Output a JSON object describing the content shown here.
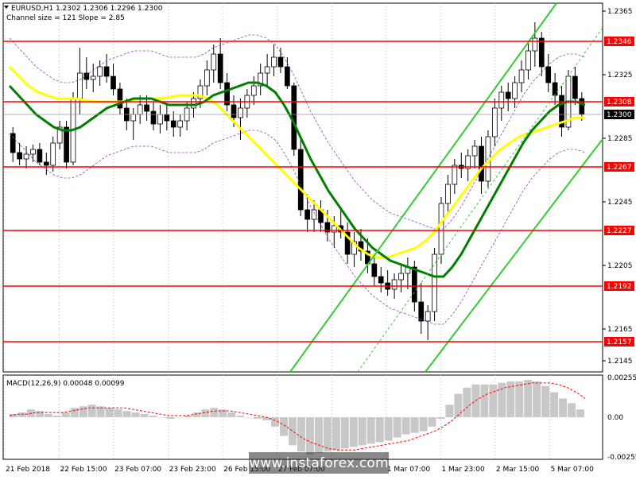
{
  "chart_data": [
    {
      "type": "line",
      "title": "EURUSD,H1  1.2302 1.2306 1.2296 1.2300",
      "subtitle": "Channel size = 121 Slope = 2.85",
      "ylim": [
        1.2138,
        1.237
      ],
      "y_ticks": [
        "1.2365",
        "1.2325",
        "1.2285",
        "1.2245",
        "1.2205",
        "1.2165",
        "1.2145"
      ],
      "x_ticks": [
        "21 Feb 2018",
        "22 Feb 15:00",
        "23 Feb 07:00",
        "23 Feb 23:00",
        "26 Feb 15:00",
        "27 Feb 07:00",
        "",
        "1 Mar 07:00",
        "1 Mar 23:00",
        "2 Mar 15:00",
        "5 Mar 07:00"
      ],
      "level_lines": [
        {
          "value": 1.2346,
          "label": "1.2346"
        },
        {
          "value": 1.2308,
          "label": "1.2308"
        },
        {
          "value": 1.2267,
          "label": "1.2267"
        },
        {
          "value": 1.2227,
          "label": "1.2227"
        },
        {
          "value": 1.2192,
          "label": "1.2192"
        },
        {
          "value": 1.2157,
          "label": "1.2157"
        }
      ],
      "current_price": {
        "value": 1.23,
        "label": "1.2300"
      },
      "candles": [
        [
          1.2288,
          1.2292,
          1.227,
          1.2276
        ],
        [
          1.2276,
          1.2282,
          1.2268,
          1.2272
        ],
        [
          1.2272,
          1.228,
          1.2266,
          1.2275
        ],
        [
          1.2275,
          1.2281,
          1.227,
          1.2278
        ],
        [
          1.2278,
          1.2282,
          1.2268,
          1.227
        ],
        [
          1.227,
          1.2276,
          1.2262,
          1.2268
        ],
        [
          1.2268,
          1.2286,
          1.2264,
          1.2282
        ],
        [
          1.2282,
          1.2296,
          1.2278,
          1.2292
        ],
        [
          1.2292,
          1.2296,
          1.2266,
          1.227
        ],
        [
          1.227,
          1.2314,
          1.2268,
          1.231
        ],
        [
          1.231,
          1.2342,
          1.23,
          1.2326
        ],
        [
          1.2326,
          1.2336,
          1.2316,
          1.2322
        ],
        [
          1.2322,
          1.2332,
          1.2314,
          1.2324
        ],
        [
          1.2324,
          1.2334,
          1.2318,
          1.233
        ],
        [
          1.233,
          1.2338,
          1.232,
          1.2324
        ],
        [
          1.2324,
          1.2332,
          1.2312,
          1.2316
        ],
        [
          1.2316,
          1.232,
          1.23,
          1.2304
        ],
        [
          1.2304,
          1.231,
          1.229,
          1.2296
        ],
        [
          1.2296,
          1.2304,
          1.2284,
          1.23
        ],
        [
          1.23,
          1.2312,
          1.2294,
          1.2306
        ],
        [
          1.2306,
          1.2312,
          1.2296,
          1.2302
        ],
        [
          1.2302,
          1.2308,
          1.229,
          1.2294
        ],
        [
          1.2294,
          1.2306,
          1.2288,
          1.23
        ],
        [
          1.23,
          1.2306,
          1.229,
          1.2296
        ],
        [
          1.2296,
          1.2302,
          1.2286,
          1.2292
        ],
        [
          1.2292,
          1.23,
          1.2286,
          1.2296
        ],
        [
          1.2296,
          1.2308,
          1.229,
          1.2304
        ],
        [
          1.2304,
          1.2314,
          1.2298,
          1.231
        ],
        [
          1.231,
          1.2322,
          1.2304,
          1.2318
        ],
        [
          1.2318,
          1.2334,
          1.2312,
          1.2328
        ],
        [
          1.2328,
          1.2344,
          1.232,
          1.2338
        ],
        [
          1.2338,
          1.2348,
          1.2316,
          1.232
        ],
        [
          1.232,
          1.2326,
          1.2302,
          1.2306
        ],
        [
          1.2306,
          1.2312,
          1.2292,
          1.2298
        ],
        [
          1.2298,
          1.231,
          1.2284,
          1.2304
        ],
        [
          1.2304,
          1.2316,
          1.2298,
          1.2312
        ],
        [
          1.2312,
          1.2324,
          1.2306,
          1.2318
        ],
        [
          1.2318,
          1.2332,
          1.2312,
          1.2326
        ],
        [
          1.2326,
          1.2338,
          1.2318,
          1.233
        ],
        [
          1.233,
          1.2344,
          1.2324,
          1.2336
        ],
        [
          1.2336,
          1.2342,
          1.2326,
          1.233
        ],
        [
          1.233,
          1.2336,
          1.2316,
          1.2318
        ],
        [
          1.2318,
          1.232,
          1.2274,
          1.2278
        ],
        [
          1.2278,
          1.2284,
          1.2236,
          1.224
        ],
        [
          1.224,
          1.225,
          1.2226,
          1.2234
        ],
        [
          1.2234,
          1.2246,
          1.2226,
          1.224
        ],
        [
          1.224,
          1.2246,
          1.2226,
          1.2232
        ],
        [
          1.2232,
          1.224,
          1.222,
          1.2226
        ],
        [
          1.2226,
          1.2236,
          1.2216,
          1.223
        ],
        [
          1.223,
          1.2242,
          1.2222,
          1.2226
        ],
        [
          1.2226,
          1.2232,
          1.2206,
          1.2212
        ],
        [
          1.2212,
          1.2226,
          1.2204,
          1.222
        ],
        [
          1.222,
          1.2228,
          1.2208,
          1.2214
        ],
        [
          1.2214,
          1.2222,
          1.22,
          1.2206
        ],
        [
          1.2206,
          1.2212,
          1.2192,
          1.2198
        ],
        [
          1.2198,
          1.2204,
          1.2188,
          1.2194
        ],
        [
          1.2194,
          1.2202,
          1.2186,
          1.219
        ],
        [
          1.219,
          1.22,
          1.2184,
          1.2196
        ],
        [
          1.2196,
          1.2206,
          1.2188,
          1.22
        ],
        [
          1.22,
          1.221,
          1.219,
          1.2204
        ],
        [
          1.2204,
          1.2208,
          1.2176,
          1.2182
        ],
        [
          1.2182,
          1.2194,
          1.2162,
          1.217
        ],
        [
          1.217,
          1.218,
          1.2158,
          1.2176
        ],
        [
          1.2176,
          1.2216,
          1.217,
          1.2212
        ],
        [
          1.2212,
          1.2248,
          1.2206,
          1.2244
        ],
        [
          1.2244,
          1.2262,
          1.2238,
          1.2256
        ],
        [
          1.2256,
          1.2272,
          1.225,
          1.2268
        ],
        [
          1.2268,
          1.2276,
          1.226,
          1.2266
        ],
        [
          1.2266,
          1.2278,
          1.2258,
          1.2274
        ],
        [
          1.2274,
          1.2284,
          1.2266,
          1.228
        ],
        [
          1.228,
          1.2286,
          1.225,
          1.2258
        ],
        [
          1.2258,
          1.229,
          1.2254,
          1.2286
        ],
        [
          1.2286,
          1.231,
          1.228,
          1.2304
        ],
        [
          1.2304,
          1.2318,
          1.2296,
          1.2314
        ],
        [
          1.2314,
          1.232,
          1.2302,
          1.231
        ],
        [
          1.231,
          1.2324,
          1.2304,
          1.232
        ],
        [
          1.232,
          1.2334,
          1.2314,
          1.2328
        ],
        [
          1.2328,
          1.2346,
          1.2322,
          1.234
        ],
        [
          1.234,
          1.2358,
          1.233,
          1.2348
        ],
        [
          1.2348,
          1.2352,
          1.2324,
          1.233
        ],
        [
          1.233,
          1.2338,
          1.2314,
          1.232
        ],
        [
          1.232,
          1.2326,
          1.2306,
          1.2312
        ],
        [
          1.2312,
          1.2318,
          1.2286,
          1.2292
        ],
        [
          1.2292,
          1.2328,
          1.229,
          1.2324
        ],
        [
          1.2324,
          1.233,
          1.2306,
          1.231
        ],
        [
          1.231,
          1.2314,
          1.2296,
          1.23
        ]
      ],
      "sma_green": [
        1.2318,
        1.2312,
        1.2306,
        1.23,
        1.2296,
        1.2292,
        1.229,
        1.229,
        1.2292,
        1.2296,
        1.23,
        1.2304,
        1.2306,
        1.2308,
        1.231,
        1.231,
        1.231,
        1.2308,
        1.2306,
        1.2306,
        1.2306,
        1.2306,
        1.2308,
        1.2312,
        1.2314,
        1.2316,
        1.2318,
        1.232,
        1.232,
        1.2318,
        1.2314,
        1.2306,
        1.2296,
        1.2284,
        1.2272,
        1.2262,
        1.2252,
        1.2244,
        1.2236,
        1.2228,
        1.2222,
        1.2216,
        1.2212,
        1.2208,
        1.2206,
        1.2204,
        1.2202,
        1.22,
        1.2198,
        1.2198,
        1.2204,
        1.2212,
        1.2222,
        1.2232,
        1.2242,
        1.2252,
        1.2262,
        1.2272,
        1.2282,
        1.229,
        1.2296,
        1.2302,
        1.2306,
        1.2308,
        1.2308,
        1.2306
      ],
      "sma_yellow": [
        1.233,
        1.2324,
        1.2318,
        1.2314,
        1.2312,
        1.231,
        1.231,
        1.231,
        1.2309,
        1.2308,
        1.2308,
        1.2308,
        1.2308,
        1.2309,
        1.231,
        1.231,
        1.231,
        1.2311,
        1.2312,
        1.2312,
        1.2312,
        1.231,
        1.2306,
        1.23,
        1.2294,
        1.2288,
        1.2282,
        1.2276,
        1.227,
        1.2264,
        1.2258,
        1.2252,
        1.2246,
        1.224,
        1.2234,
        1.2228,
        1.2222,
        1.2216,
        1.2212,
        1.221,
        1.221,
        1.2212,
        1.2214,
        1.2216,
        1.222,
        1.2226,
        1.2234,
        1.2242,
        1.225,
        1.2258,
        1.2266,
        1.2272,
        1.2278,
        1.2282,
        1.2286,
        1.2288,
        1.229,
        1.2292,
        1.2294,
        1.2296,
        1.2298,
        1.2298
      ]
    },
    {
      "type": "bar",
      "title": "MACD(12,26,9) 0.00048 0.00099",
      "ylim": [
        -0.0027,
        0.0027
      ],
      "y_ticks": [
        "0.00255",
        "0.00",
        "-0.00255"
      ],
      "series": [
        {
          "name": "main",
          "values": [
            0.0002,
            0.0003,
            0.0005,
            0.0004,
            0.0002,
            0.0001,
            0.0003,
            0.0006,
            0.0007,
            0.0008,
            0.0007,
            0.0006,
            0.0005,
            0.0004,
            0.0003,
            0.0002,
            0.0001,
            0.0,
            -0.0001,
            0.0,
            0.0001,
            0.0003,
            0.0005,
            0.0006,
            0.0005,
            0.0003,
            0.0001,
            0.0,
            -0.0001,
            -0.0002,
            -0.0006,
            -0.0012,
            -0.0018,
            -0.0022,
            -0.0024,
            -0.0023,
            -0.0022,
            -0.0021,
            -0.002,
            -0.0019,
            -0.0018,
            -0.0017,
            -0.0016,
            -0.0015,
            -0.0013,
            -0.0011,
            -0.001,
            -0.0009,
            -0.0006,
            -0.0001,
            0.0008,
            0.0015,
            0.0019,
            0.0021,
            0.0021,
            0.0021,
            0.0022,
            0.0023,
            0.0023,
            0.0024,
            0.0023,
            0.002,
            0.0016,
            0.0012,
            0.0009,
            0.0005
          ]
        },
        {
          "name": "signal",
          "values": [
            0.0001,
            0.0002,
            0.0002,
            0.0003,
            0.0003,
            0.0003,
            0.0003,
            0.0004,
            0.0005,
            0.0006,
            0.0006,
            0.0006,
            0.0006,
            0.0006,
            0.0005,
            0.0004,
            0.0003,
            0.0002,
            0.0001,
            0.0001,
            0.0001,
            0.0002,
            0.0003,
            0.0004,
            0.0004,
            0.0004,
            0.0003,
            0.0002,
            0.0001,
            0.0,
            -0.0002,
            -0.0005,
            -0.0009,
            -0.0013,
            -0.0016,
            -0.0018,
            -0.002,
            -0.0021,
            -0.0021,
            -0.0021,
            -0.002,
            -0.0019,
            -0.0018,
            -0.0017,
            -0.0016,
            -0.0015,
            -0.0013,
            -0.0011,
            -0.0009,
            -0.0006,
            -0.0002,
            0.0003,
            0.0008,
            0.0012,
            0.0015,
            0.0017,
            0.0019,
            0.002,
            0.0021,
            0.0022,
            0.0022,
            0.0022,
            0.0021,
            0.0019,
            0.0016,
            0.0012
          ]
        }
      ]
    }
  ],
  "watermark": "www.instaforex.com",
  "colors": {
    "background": "#ffffff",
    "candle": "#000000",
    "level_line": "#ff0000",
    "level_label_bg": "#ff0000",
    "current_label_bg": "#000000",
    "sma_green": "#007f00",
    "sma_yellow": "#ffff00",
    "channel": "#33cc33",
    "envelope": "#a040c0",
    "macd_hist": "#c8c8c8",
    "macd_signal": "#ff0000",
    "grid": "#c0c0c0"
  }
}
